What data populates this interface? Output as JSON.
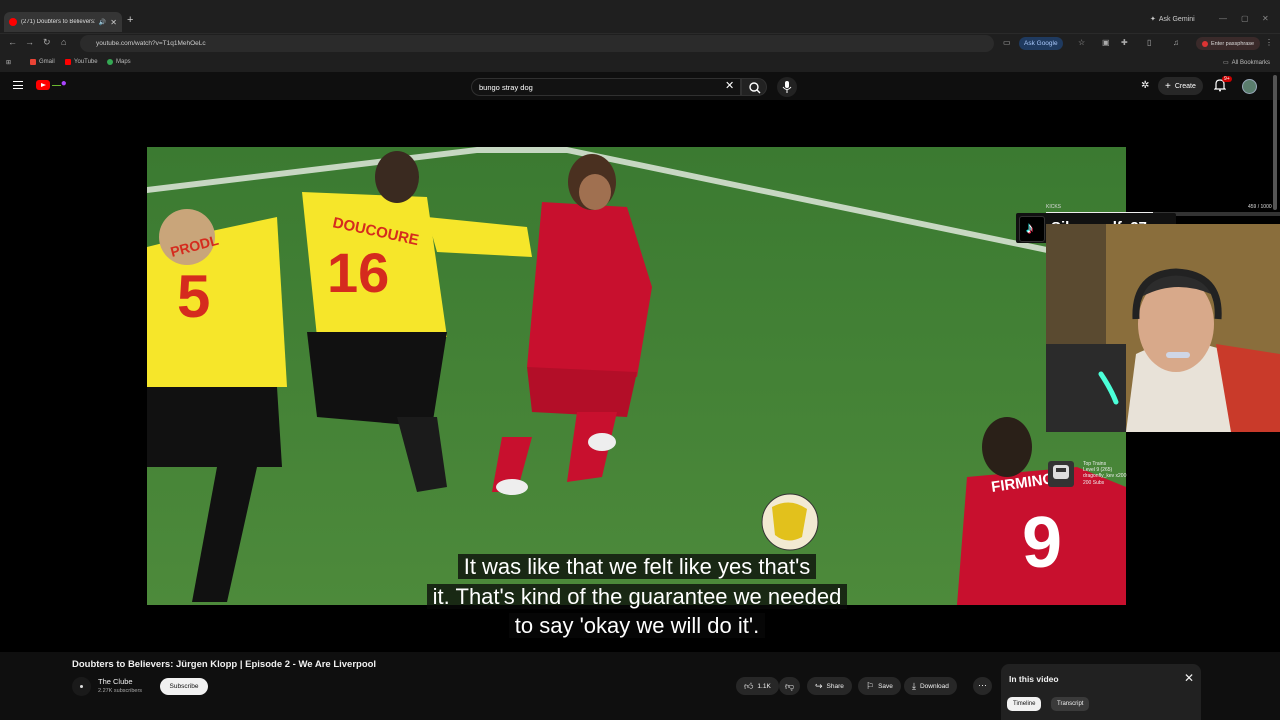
{
  "browser": {
    "tab_title": "(271) Doubters to Believers:",
    "new_tab": "+",
    "ask_gemini": "Ask Gemini",
    "url": "youtube.com/watch?v=T1q1MehOeLc",
    "ask_google": "Ask Google",
    "passphrase_label": "Enter passphrase",
    "bookmarks": [
      "Gmail",
      "YouTube",
      "Maps"
    ],
    "all_bookmarks": "All Bookmarks"
  },
  "youtube": {
    "search_value": "bungo stray dog",
    "create_label": "Create",
    "notification_count": "9+"
  },
  "video": {
    "captions": [
      "It was like that we felt like yes that's",
      "it. That's kind of the guarantee we needed",
      "to say 'okay we will do it'."
    ],
    "jersey_numbers": {
      "prodl": "5",
      "doucoure": "16",
      "firmino": "9"
    },
    "jersey_names": {
      "prodl": "PRODL",
      "doucoure": "DOUCOURE",
      "firmino": "FIRMINO"
    }
  },
  "overlay": {
    "username": "Silverwolf_27",
    "kicks_label": "KICKS",
    "kicks_count": "459 / 1000",
    "kicks_progress": 0.459,
    "train_lines": [
      "Top Trains",
      "Level 9 (265)",
      "dragonfly_kev x200",
      "200 Subs"
    ]
  },
  "details": {
    "title": "Doubters to Believers: Jürgen Klopp | Episode 2 - We Are Liverpool",
    "channel_name": "The Clube",
    "subscribers": "2.27K subscribers",
    "subscribe_label": "Subscribe",
    "likes": "1.1K",
    "share_label": "Share",
    "save_label": "Save",
    "download_label": "Download"
  },
  "chapters": {
    "title": "In this video",
    "tab_timeline": "Timeline",
    "tab_transcript": "Transcript"
  },
  "colors": {
    "youtube_red": "#ff0000",
    "liverpool_red": "#c8102e",
    "watford_yellow": "#f6e62a"
  }
}
